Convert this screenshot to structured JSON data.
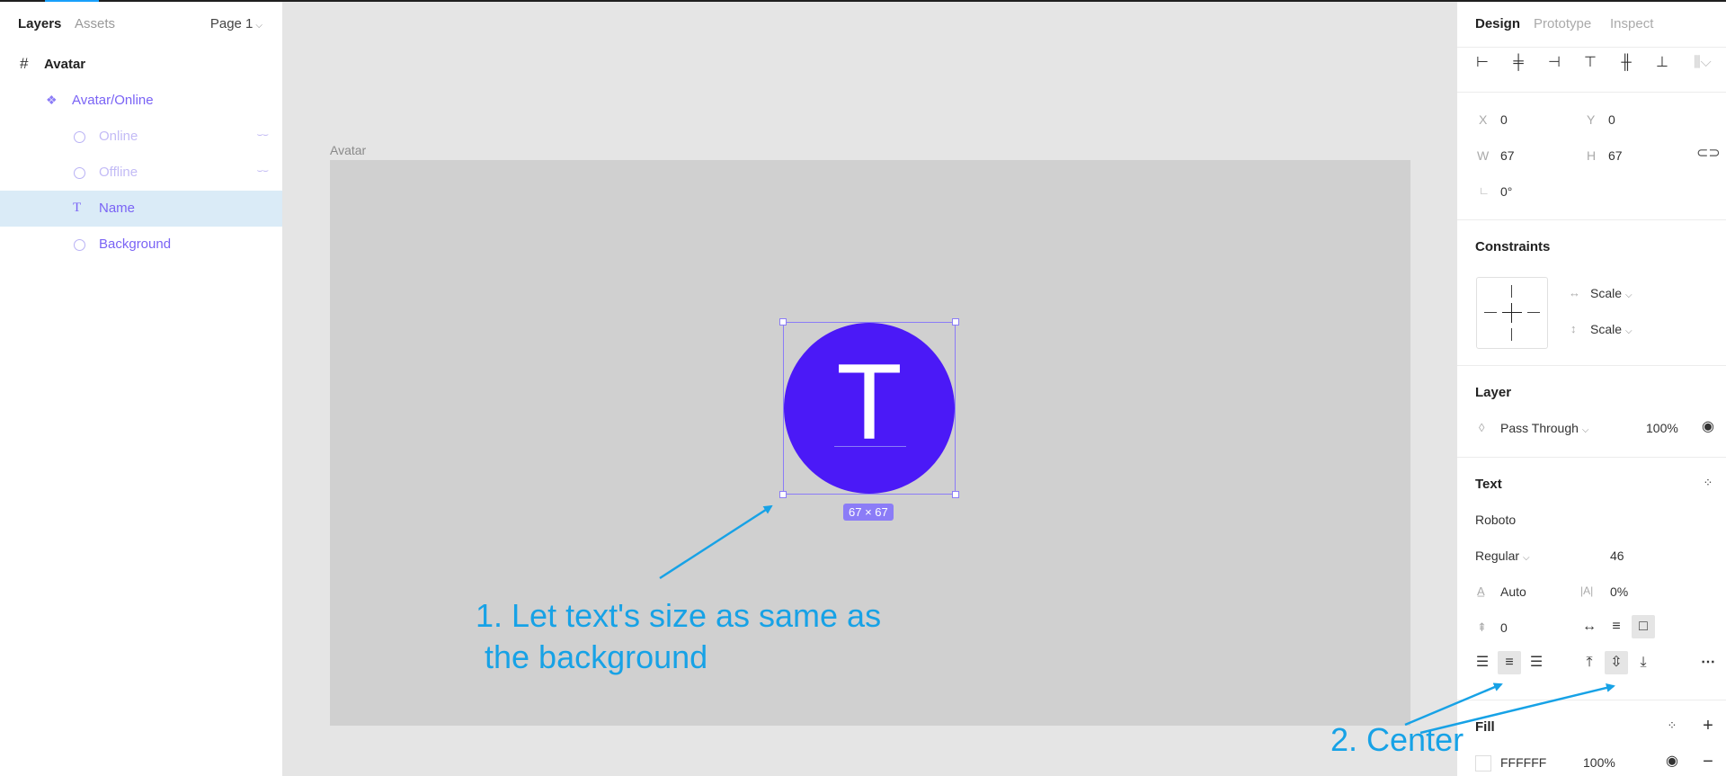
{
  "left_panel": {
    "tabs": [
      {
        "label": "Layers"
      },
      {
        "label": "Assets"
      }
    ],
    "page_selector": "Page 1",
    "layers": [
      {
        "label": "Avatar",
        "icon": "frame-icon"
      },
      {
        "label": "Avatar/Online",
        "icon": "component-icon"
      },
      {
        "label": "Online",
        "icon": "ellipse-icon",
        "hidden": true
      },
      {
        "label": "Offline",
        "icon": "ellipse-icon",
        "hidden": true
      },
      {
        "label": "Name",
        "icon": "text-icon",
        "selected": true
      },
      {
        "label": "Background",
        "icon": "ellipse-icon"
      }
    ]
  },
  "canvas": {
    "frame_label": "Avatar",
    "avatar_letter": "T",
    "selection_size": "67 × 67",
    "avatar_color": "#4b19f7",
    "selection_color": "#8b7cf7"
  },
  "right_panel": {
    "tabs": [
      {
        "label": "Design"
      },
      {
        "label": "Prototype"
      },
      {
        "label": "Inspect"
      }
    ],
    "position": {
      "x_label": "X",
      "x": "0",
      "y_label": "Y",
      "y": "0",
      "w_label": "W",
      "w": "67",
      "h_label": "H",
      "h": "67",
      "rotation": "0°"
    },
    "constraints": {
      "title": "Constraints",
      "horizontal": "Scale",
      "vertical": "Scale"
    },
    "layer": {
      "title": "Layer",
      "blend_mode": "Pass Through",
      "opacity": "100%"
    },
    "text": {
      "title": "Text",
      "font_family": "Roboto",
      "font_weight": "Regular",
      "font_size": "46",
      "line_height": "Auto",
      "letter_spacing": "0%",
      "paragraph_spacing": "0"
    },
    "fill": {
      "title": "Fill",
      "color_hex": "FFFFFF",
      "opacity": "100%"
    }
  },
  "annotations": {
    "note1": "1. Let text's size as same as\n the background",
    "note2": "2. Center",
    "arrow_color": "#17a2e6"
  }
}
